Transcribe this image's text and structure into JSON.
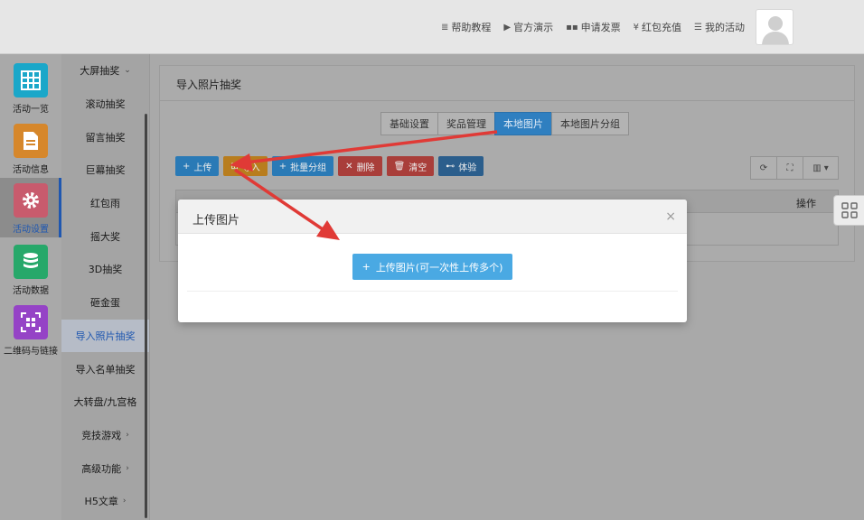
{
  "topnav": {
    "items": [
      {
        "label": "帮助教程",
        "icon": "doc-lines-icon",
        "glyph": "≣"
      },
      {
        "label": "官方演示",
        "icon": "play-circle-icon",
        "glyph": "▶"
      },
      {
        "label": "申请发票",
        "icon": "ticket-icon",
        "glyph": "▪▪"
      },
      {
        "label": "红包充值",
        "icon": "yen-icon",
        "glyph": "¥"
      },
      {
        "label": "我的活动",
        "icon": "list-icon",
        "glyph": "☰"
      }
    ]
  },
  "rail": {
    "items": [
      {
        "label": "活动一览",
        "color": "#1aa7c9",
        "icon": "grid-icon"
      },
      {
        "label": "活动信息",
        "color": "#d6872b",
        "icon": "document-icon"
      },
      {
        "label": "活动设置",
        "color": "#c85b6d",
        "icon": "gear-icon",
        "active": true
      },
      {
        "label": "活动数据",
        "color": "#27a86a",
        "icon": "database-icon"
      },
      {
        "label": "二维码与链接",
        "color": "#9543c6",
        "icon": "qrcode-icon"
      }
    ]
  },
  "subnav": {
    "items": [
      {
        "label": "大屏抽奖",
        "arrow": "⌄"
      },
      {
        "label": "滚动抽奖"
      },
      {
        "label": "留言抽奖"
      },
      {
        "label": "巨幕抽奖"
      },
      {
        "label": "红包雨"
      },
      {
        "label": "摇大奖"
      },
      {
        "label": "3D抽奖"
      },
      {
        "label": "砸金蛋"
      },
      {
        "label": "导入照片抽奖",
        "active": true
      },
      {
        "label": "导入名单抽奖"
      },
      {
        "label": "大转盘/九宫格"
      },
      {
        "label": "竞技游戏",
        "arrow": "›"
      },
      {
        "label": "高级功能",
        "arrow": "›"
      },
      {
        "label": "H5文章",
        "arrow": "›"
      }
    ]
  },
  "panel": {
    "title": "导入照片抽奖",
    "tabs": [
      "基础设置",
      "奖品管理",
      "本地图片",
      "本地图片分组"
    ],
    "active_tab": 2,
    "toolbar": [
      {
        "label": "上传",
        "icon": "+",
        "color": "blue"
      },
      {
        "label": "导入",
        "icon": "⊞",
        "color": "orange"
      },
      {
        "label": "批量分组",
        "icon": "+",
        "color": "blue"
      },
      {
        "label": "删除",
        "icon": "✕",
        "color": "red"
      },
      {
        "label": "清空",
        "icon": "🗑",
        "color": "red"
      },
      {
        "label": "体验",
        "icon": "⊷",
        "color": "navy"
      }
    ],
    "table": {
      "actions_header": "操作"
    }
  },
  "modal": {
    "title": "上传图片",
    "close": "×",
    "upload_button": "上传图片(可一次性上传多个)",
    "upload_icon": "+"
  },
  "colors": {
    "accent": "#2f7fc0",
    "upload": "#4aa9e3",
    "arrow": "#e03a36"
  }
}
